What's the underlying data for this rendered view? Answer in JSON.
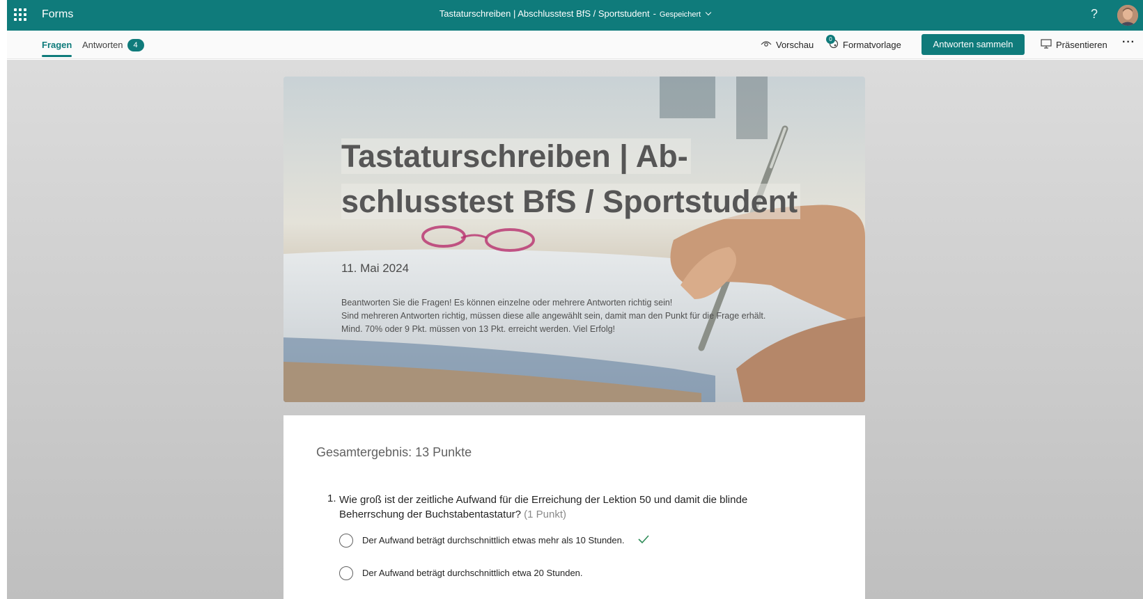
{
  "app": {
    "name": "Forms",
    "icon": "waffle-icon"
  },
  "header": {
    "doc_title": "Tastaturschreiben | Abschlusstest BfS / Sportstudent",
    "separator": "-",
    "save_status": "Gespeichert",
    "help_label": "?"
  },
  "tabs": {
    "questions": "Fragen",
    "responses": "Antworten",
    "responses_count": "4"
  },
  "toolbar": {
    "preview": "Vorschau",
    "theme": "Formatvorlage",
    "theme_badge": "0",
    "collect": "Antworten sammeln",
    "present": "Präsentieren",
    "more": "···"
  },
  "banner": {
    "title_line1": "Tastaturschreiben | Ab-",
    "title_line2": "schlusstest BfS / Sportstudent",
    "date": "11. Mai 2024",
    "description": [
      "Beantworten Sie die Fragen! Es können einzelne oder mehrere Antworten richtig sein!",
      "Sind mehreren Antworten richtig, müssen diese alle angewählt sein, damit man den Punkt für die Frage erhält.",
      "Mind. 70% oder 9 Pkt. müssen von 13 Pkt. erreicht werden. Viel Erfolg!"
    ]
  },
  "quiz": {
    "total": "Gesamtergebnis: 13 Punkte",
    "question": {
      "number": "1.",
      "text_line1": "Wie groß ist der zeitliche Aufwand für die Erreichung der Lektion 50 und damit die blinde",
      "text_line2": "Beherrschung der Buchstabentastatur?",
      "points": "(1 Punkt)",
      "options": [
        {
          "label": "Der Aufwand beträgt durchschnittlich etwas mehr als 10 Stunden.",
          "correct": true
        },
        {
          "label": "Der Aufwand beträgt durchschnittlich etwa 20 Stunden.",
          "correct": false
        }
      ]
    }
  },
  "colors": {
    "brand": "#0f7b7b",
    "correct": "#2e8b57"
  }
}
